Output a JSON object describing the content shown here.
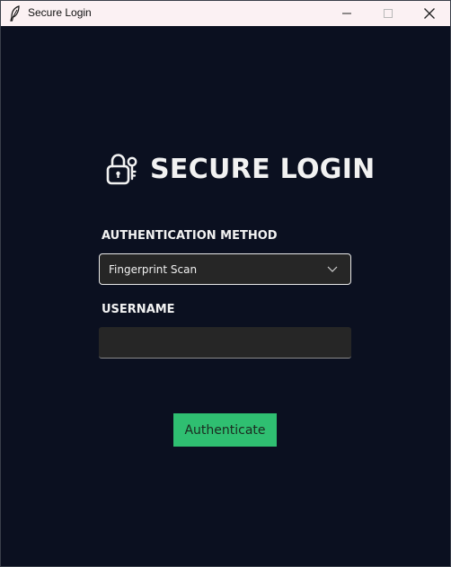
{
  "window": {
    "title": "Secure Login"
  },
  "header": {
    "title": "SECURE LOGIN",
    "icon": "lock-key-icon"
  },
  "auth_method": {
    "label": "AUTHENTICATION METHOD",
    "selected": "Fingerprint Scan"
  },
  "username": {
    "label": "USERNAME",
    "value": ""
  },
  "actions": {
    "authenticate_label": "Authenticate"
  },
  "colors": {
    "background": "#0b1020",
    "titlebar": "#fbf1f3",
    "field_background": "#262626",
    "accent_button": "#2fbf71",
    "text": "#f2f2f2"
  }
}
